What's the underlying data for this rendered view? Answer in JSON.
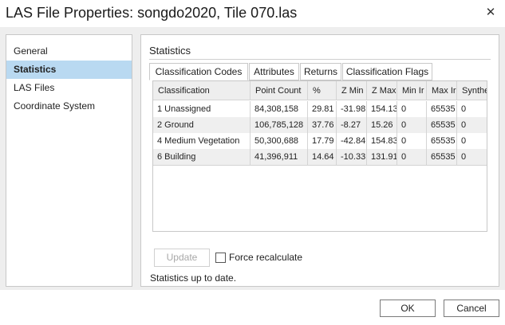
{
  "window": {
    "title": "LAS File Properties: songdo2020, Tile 070.las",
    "close_icon": "close-icon"
  },
  "sidebar": {
    "items": [
      {
        "label": "General",
        "selected": false
      },
      {
        "label": "Statistics",
        "selected": true
      },
      {
        "label": "LAS Files",
        "selected": false
      },
      {
        "label": "Coordinate System",
        "selected": false
      }
    ]
  },
  "statistics": {
    "heading": "Statistics",
    "tabs": [
      {
        "label": "Classification Codes",
        "active": true
      },
      {
        "label": "Attributes",
        "active": false
      },
      {
        "label": "Returns",
        "active": false
      },
      {
        "label": "Classification Flags",
        "active": false
      }
    ],
    "table": {
      "columns": [
        "Classification",
        "Point Count",
        "%",
        "Z Min",
        "Z Max",
        "Min Ir",
        "Max Ir",
        "Synthe"
      ],
      "rows": [
        [
          "1  Unassigned",
          "84,308,158",
          "29.81",
          "-31.98",
          "154.13",
          "0",
          "65535",
          "0"
        ],
        [
          "2  Ground",
          "106,785,128",
          "37.76",
          "-8.27",
          "15.26",
          "0",
          "65535",
          "0"
        ],
        [
          "4  Medium Vegetation",
          "50,300,688",
          "17.79",
          "-42.84",
          "154.83",
          "0",
          "65535",
          "0"
        ],
        [
          "6  Building",
          "41,396,911",
          "14.64",
          "-10.33",
          "131.91",
          "0",
          "65535",
          "0"
        ]
      ]
    },
    "update_label": "Update",
    "force_recalculate_label": "Force recalculate",
    "force_recalculate_checked": false,
    "status": "Statistics up to date."
  },
  "footer": {
    "ok_label": "OK",
    "cancel_label": "Cancel"
  },
  "colors": {
    "selection": "#b9d9f1",
    "panel_bg": "#eeeeee",
    "alt_row": "#efefef"
  }
}
